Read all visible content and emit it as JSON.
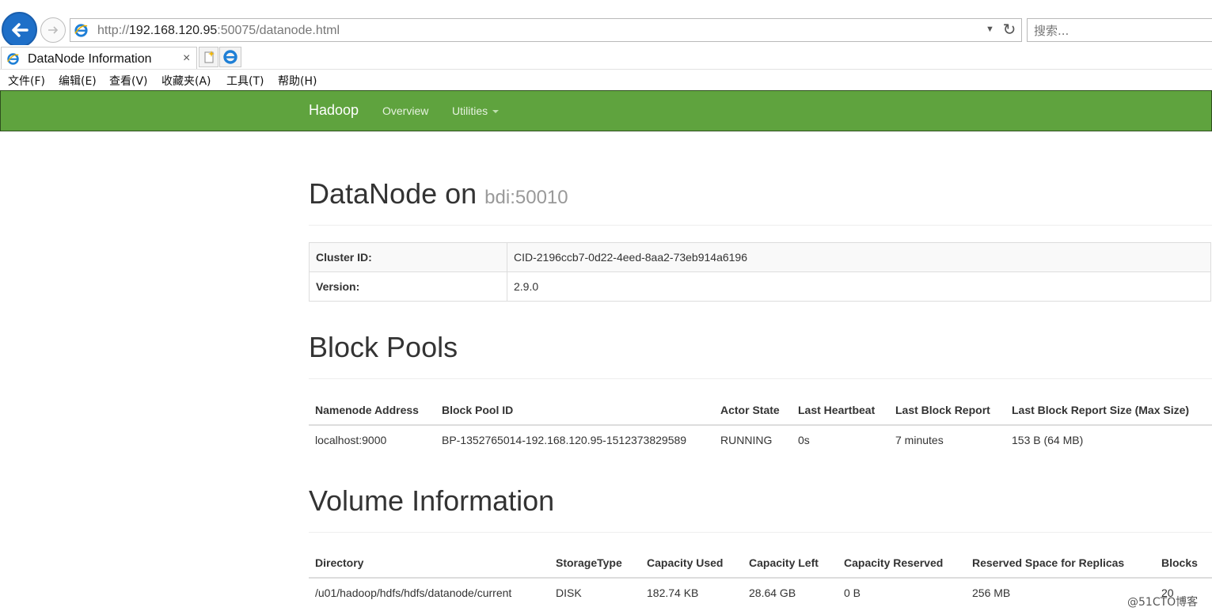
{
  "browser": {
    "url_prefix": "http://",
    "url_host": "192.168.120.95",
    "url_rest": ":50075/datanode.html",
    "search_placeholder": "搜索...",
    "tab_title": "DataNode Information",
    "tab_close": "×",
    "menu": [
      "文件(F)",
      "编辑(E)",
      "查看(V)",
      "收藏夹(A)",
      "工具(T)",
      "帮助(H)"
    ]
  },
  "navbar": {
    "brand": "Hadoop",
    "items": [
      "Overview",
      "Utilities"
    ],
    "color": "#5fa33e"
  },
  "page": {
    "heading": "DataNode on",
    "heading_sub": "bdi:50010"
  },
  "info": [
    {
      "label": "Cluster ID:",
      "value": "CID-2196ccb7-0d22-4eed-8aa2-73eb914a6196"
    },
    {
      "label": "Version:",
      "value": "2.9.0"
    }
  ],
  "block_pools": {
    "title": "Block Pools",
    "columns": [
      "Namenode Address",
      "Block Pool ID",
      "Actor State",
      "Last Heartbeat",
      "Last Block Report",
      "Last Block Report Size (Max Size)"
    ],
    "rows": [
      [
        "localhost:9000",
        "BP-1352765014-192.168.120.95-1512373829589",
        "RUNNING",
        "0s",
        "7 minutes",
        "153 B (64 MB)"
      ]
    ]
  },
  "volumes": {
    "title": "Volume Information",
    "columns": [
      "Directory",
      "StorageType",
      "Capacity Used",
      "Capacity Left",
      "Capacity Reserved",
      "Reserved Space for Replicas",
      "Blocks"
    ],
    "rows": [
      [
        "/u01/hadoop/hdfs/hdfs/datanode/current",
        "DISK",
        "182.74 KB",
        "28.64 GB",
        "0 B",
        "256 MB",
        "20"
      ]
    ]
  },
  "watermark": "@51CTO博客"
}
